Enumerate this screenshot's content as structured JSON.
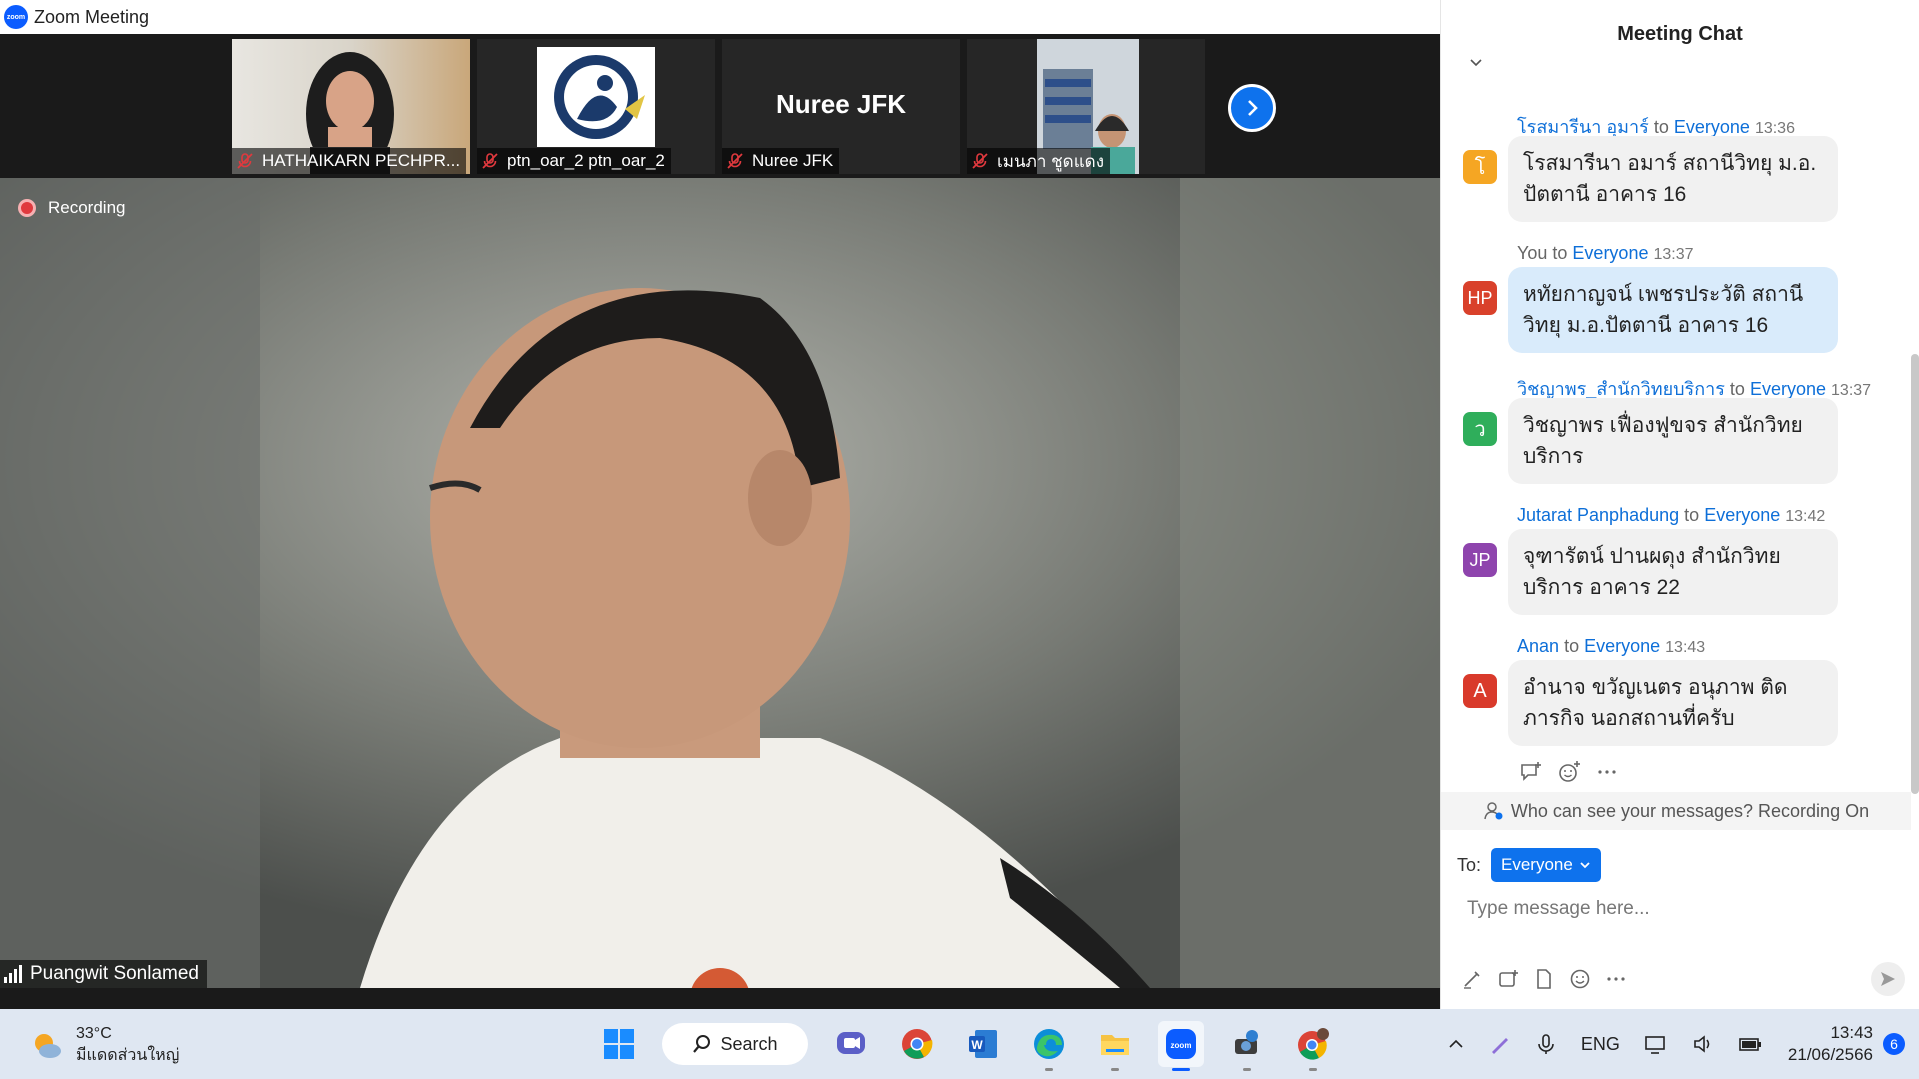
{
  "window": {
    "title": "Zoom Meeting",
    "logo_text": "zoom"
  },
  "thumbnails": [
    {
      "name": "HATHAIKARN PECHPR..."
    },
    {
      "name": "ptn_oar_2 ptn_oar_2"
    },
    {
      "name": "Nuree JFK",
      "display_name": "Nuree JFK"
    },
    {
      "name": "เมนภา ชูดแดง"
    }
  ],
  "main_video": {
    "recording_label": "Recording",
    "speaker_name": "Puangwit Sonlamed"
  },
  "chat": {
    "title": "Meeting Chat",
    "messages": [
      {
        "avatar": "โ",
        "avatar_color": "#f5a623",
        "sender": "โรสมารีนา  อุมาร์",
        "to": "to",
        "target": "Everyone",
        "time": "13:36",
        "text": "โรสมารีนา  อมาร์ สถานีวิทยุ ม.อ. ปัตตานี  อาคาร 16",
        "self": false
      },
      {
        "avatar": "HP",
        "avatar_color": "#d9412b",
        "sender": "You",
        "to": "to",
        "target": "Everyone",
        "time": "13:37",
        "text": "หทัยกาญจน์ เพชรประวัติ สถานีวิทยุ ม.อ.ปัตตานี อาคาร 16",
        "self": true
      },
      {
        "avatar": "ว",
        "avatar_color": "#2fae5b",
        "sender": "วิชญาพร_สำนักวิทยบริการ",
        "to": "to",
        "target": "Everyone",
        "time": "13:37",
        "text": "วิชญาพร เฟื่องฟูขจร สำนักวิทย บริการ",
        "self": false
      },
      {
        "avatar": "JP",
        "avatar_color": "#8e44ad",
        "sender": "Jutarat Panphadung",
        "to": "to",
        "target": "Everyone",
        "time": "13:42",
        "text": "จุฑารัตน์ ปานผดุง สำนักวิทย บริการ อาคาร 22",
        "self": false
      },
      {
        "avatar": "A",
        "avatar_color": "#d93a2b",
        "sender": "Anan",
        "to": "to",
        "target": "Everyone",
        "time": "13:43",
        "text": "อำนาจ ขวัญเนตร อนุภาพ ติด ภารกิจ นอกสถานที่ครับ",
        "self": false
      }
    ],
    "privacy_text": "Who can see your messages? Recording On",
    "to_label": "To:",
    "recipient": "Everyone",
    "input_placeholder": "Type message here..."
  },
  "taskbar": {
    "weather_temp": "33°C",
    "weather_desc": "มีแดดส่วนใหญ่",
    "search_label": "Search",
    "language": "ENG",
    "time": "13:43",
    "date": "21/06/2566",
    "notification_count": "6"
  }
}
